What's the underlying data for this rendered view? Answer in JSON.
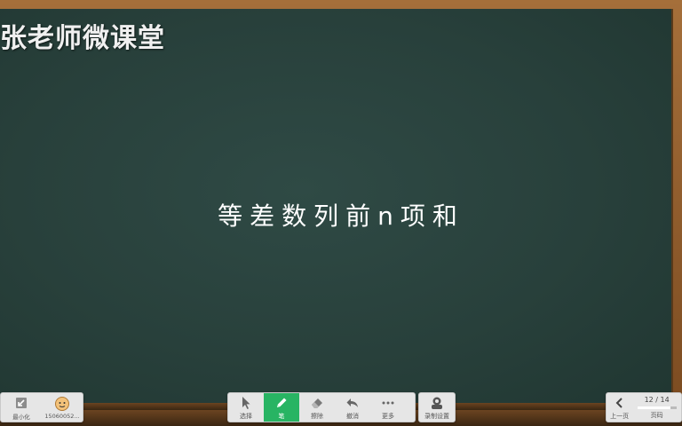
{
  "watermark": "张老师微课堂",
  "lesson_title": "等差数列前n项和",
  "left_panel": {
    "minimize_label": "最小化",
    "user_label": "15060052..."
  },
  "tools": {
    "select_label": "选择",
    "pen_label": "笔",
    "eraser_label": "擦除",
    "undo_label": "撤消",
    "more_label": "更多"
  },
  "record": {
    "settings_label": "录制设置"
  },
  "page_nav": {
    "prev_label": "上一页",
    "counter": "12 / 14",
    "pages_label": "页码",
    "current": 12,
    "total": 14
  },
  "colors": {
    "board": "#2a443f",
    "pen_active": "#28b463",
    "frame": "#8a5a2b"
  },
  "icons": {
    "minimize": "minimize-icon",
    "user": "avatar-icon",
    "select": "cursor-icon",
    "pen": "pencil-icon",
    "eraser": "eraser-icon",
    "undo": "undo-icon",
    "more": "ellipsis-icon",
    "record": "recorder-icon",
    "prev": "chevron-left-icon"
  }
}
